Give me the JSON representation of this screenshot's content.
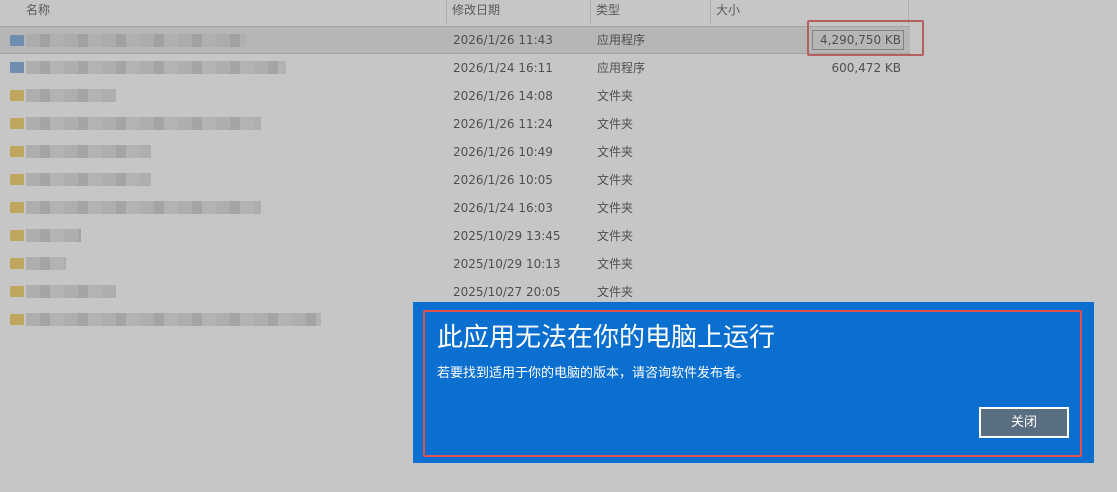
{
  "explorer": {
    "columns": {
      "name": "名称",
      "date": "修改日期",
      "type": "类型",
      "size": "大小"
    },
    "rows": [
      {
        "icon": "app-icon",
        "date": "2026/1/26 11:43",
        "type": "应用程序",
        "size": "4,290,750 KB",
        "selected": true
      },
      {
        "icon": "app-icon",
        "date": "2026/1/24 16:11",
        "type": "应用程序",
        "size": "600,472 KB",
        "selected": false
      },
      {
        "icon": "folder-icon",
        "date": "2026/1/26 14:08",
        "type": "文件夹",
        "size": "",
        "selected": false
      },
      {
        "icon": "folder-icon",
        "date": "2026/1/26 11:24",
        "type": "文件夹",
        "size": "",
        "selected": false
      },
      {
        "icon": "folder-icon",
        "date": "2026/1/26 10:49",
        "type": "文件夹",
        "size": "",
        "selected": false
      },
      {
        "icon": "folder-icon",
        "date": "2026/1/26 10:05",
        "type": "文件夹",
        "size": "",
        "selected": false
      },
      {
        "icon": "folder-icon",
        "date": "2026/1/24 16:03",
        "type": "文件夹",
        "size": "",
        "selected": false
      },
      {
        "icon": "folder-icon",
        "date": "2025/10/29 13:45",
        "type": "文件夹",
        "size": "",
        "selected": false
      },
      {
        "icon": "folder-icon",
        "date": "2025/10/29 10:13",
        "type": "文件夹",
        "size": "",
        "selected": false
      },
      {
        "icon": "folder-icon",
        "date": "2025/10/27 20:05",
        "type": "文件夹",
        "size": "",
        "selected": false
      },
      {
        "icon": "folder-icon",
        "date": "",
        "type": "",
        "size": "",
        "selected": false
      }
    ]
  },
  "dialog": {
    "title": "此应用无法在你的电脑上运行",
    "message": "若要找到适用于你的电脑的版本，请咨询软件发布者。",
    "close_label": "关闭",
    "background_color": "#0a6fcf"
  },
  "annotations": {
    "highlight_color": "#e05050"
  }
}
